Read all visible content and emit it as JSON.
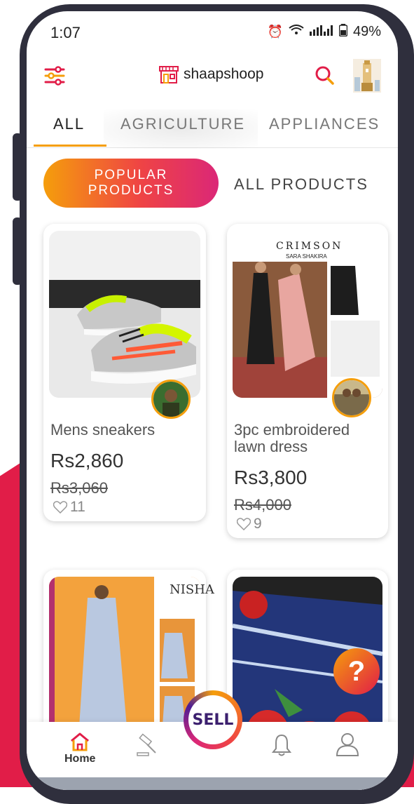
{
  "status": {
    "time": "1:07",
    "battery": "49%"
  },
  "header": {
    "logo_text": "shaapshoop"
  },
  "tabs": [
    {
      "label": "ALL"
    },
    {
      "label": "AGRICULTURE"
    },
    {
      "label": "APPLIANCES"
    }
  ],
  "segments": {
    "popular": "POPULAR PRODUCTS",
    "all": "ALL PRODUCTS"
  },
  "products": [
    {
      "title": "Mens sneakers",
      "price": "Rs2,860",
      "old_price": "Rs3,060",
      "likes": "11"
    },
    {
      "title": "3pc embroidered lawn dress",
      "price": "Rs3,800",
      "old_price": "Rs4,000",
      "likes": "9"
    },
    {
      "title": "",
      "price": "",
      "old_price": "",
      "likes": ""
    },
    {
      "title": "",
      "price": "",
      "old_price": "",
      "likes": ""
    }
  ],
  "product_images": {
    "crimson_brand": "CRIMSON",
    "crimson_sub": "SARA SHAKIRA",
    "nisha_brand": "NISHA"
  },
  "nav": {
    "home": "Home",
    "sell": "SELL"
  },
  "help": {
    "label": "?"
  },
  "colors": {
    "accent": "#f59e0b",
    "brand": "#e11d48",
    "pink": "#db2777",
    "dark": "#2f2f3d"
  }
}
